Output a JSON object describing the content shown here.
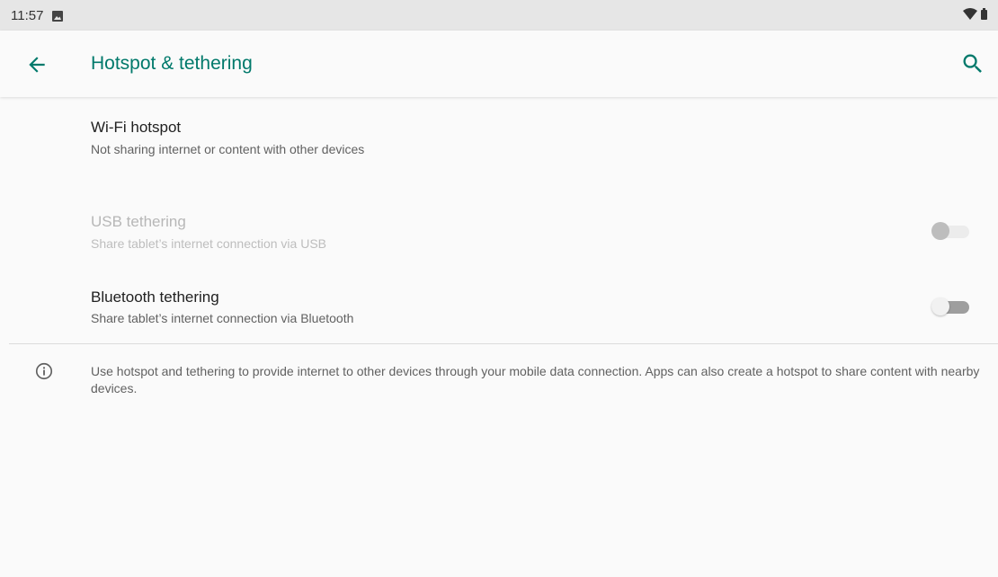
{
  "status_bar": {
    "time": "11:57",
    "icons": [
      "image-icon",
      "wifi-icon",
      "battery-icon"
    ]
  },
  "app_bar": {
    "title": "Hotspot & tethering",
    "accent_color": "#00796b",
    "back_icon": "arrow-back-icon",
    "search_icon": "search-icon"
  },
  "items": [
    {
      "title": "Wi-Fi hotspot",
      "subtitle": "Not sharing internet or content with other devices",
      "enabled": true
    },
    {
      "title": "USB tethering",
      "subtitle": "Share tablet’s internet connection via USB",
      "enabled": false,
      "toggle_on": false
    },
    {
      "title": "Bluetooth tethering",
      "subtitle": "Share tablet’s internet connection via Bluetooth",
      "enabled": true,
      "toggle_on": false
    }
  ],
  "footer": {
    "icon": "info-icon",
    "text": "Use hotspot and tethering to provide internet to other devices through your mobile data connection. Apps can also create a hotspot to share content with nearby devices."
  }
}
